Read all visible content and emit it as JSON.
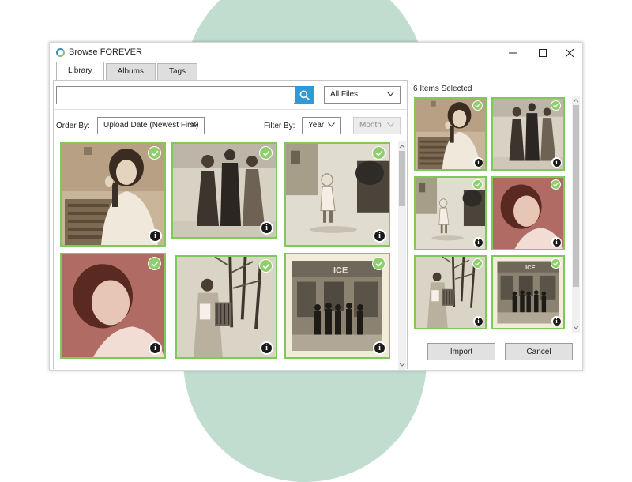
{
  "window": {
    "title": "Browse FOREVER"
  },
  "tabs": [
    {
      "label": "Library",
      "active": true
    },
    {
      "label": "Albums",
      "active": false
    },
    {
      "label": "Tags",
      "active": false
    }
  ],
  "search": {
    "value": "",
    "placeholder": ""
  },
  "file_filter": {
    "selected": "All Files"
  },
  "order_by": {
    "label": "Order By:",
    "selected": "Upload Date (Newest First)"
  },
  "filter_by": {
    "label": "Filter By:",
    "year": "Year",
    "month": "Month"
  },
  "library_photos": [
    {
      "subject": "woman-drinking-photo",
      "selected": true
    },
    {
      "subject": "family-trio-photo",
      "selected": true
    },
    {
      "subject": "toddler-street-photo",
      "selected": true
    },
    {
      "subject": "woman-portrait-photo",
      "selected": true
    },
    {
      "subject": "accordion-player-photo",
      "selected": true
    },
    {
      "subject": "group-storefront-photo",
      "selected": true
    }
  ],
  "selection": {
    "count_label": "6 Items Selected"
  },
  "buttons": {
    "import": "Import",
    "cancel": "Cancel"
  },
  "colors": {
    "accent_blue": "#2e9ad6",
    "selected_green": "#7ec957",
    "background_mint": "#c1ddd0"
  }
}
